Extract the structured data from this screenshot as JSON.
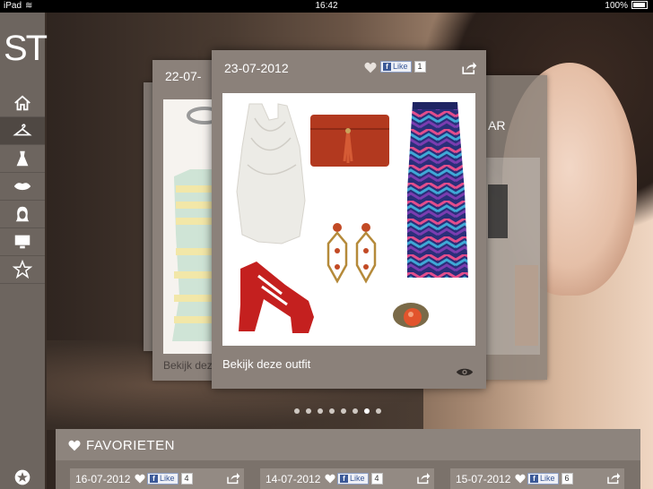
{
  "status_bar": {
    "device": "iPad",
    "time": "16:42",
    "battery": "100%"
  },
  "app": {
    "logo": "ST"
  },
  "sidebar": {
    "items": [
      {
        "icon": "home-icon"
      },
      {
        "icon": "hanger-icon"
      },
      {
        "icon": "dress-icon"
      },
      {
        "icon": "lips-icon"
      },
      {
        "icon": "hair-icon"
      },
      {
        "icon": "monitor-icon"
      },
      {
        "icon": "star-icon"
      }
    ],
    "bottom_icon": "star-badge-icon"
  },
  "main_card": {
    "date": "23-07-2012",
    "fb_like_label": "Like",
    "fb_like_count": "1",
    "footer_text": "Bekijk deze outfit"
  },
  "back_card_left": {
    "date": "22-07-",
    "footer_text": "Bekijk deze"
  },
  "back_card_right": {
    "label": "AR"
  },
  "pager": {
    "count": 8,
    "active": 6
  },
  "favorites": {
    "title": "FAVORIETEN",
    "items": [
      {
        "date": "16-07-2012",
        "like_label": "Like",
        "like_count": "4"
      },
      {
        "date": "14-07-2012",
        "like_label": "Like",
        "like_count": "4"
      },
      {
        "date": "15-07-2012",
        "like_label": "Like",
        "like_count": "6"
      }
    ]
  },
  "colors": {
    "sidebar": "#6d655f",
    "card": "#8b817a",
    "accent_red": "#c0312a",
    "facebook": "#3b5998"
  }
}
